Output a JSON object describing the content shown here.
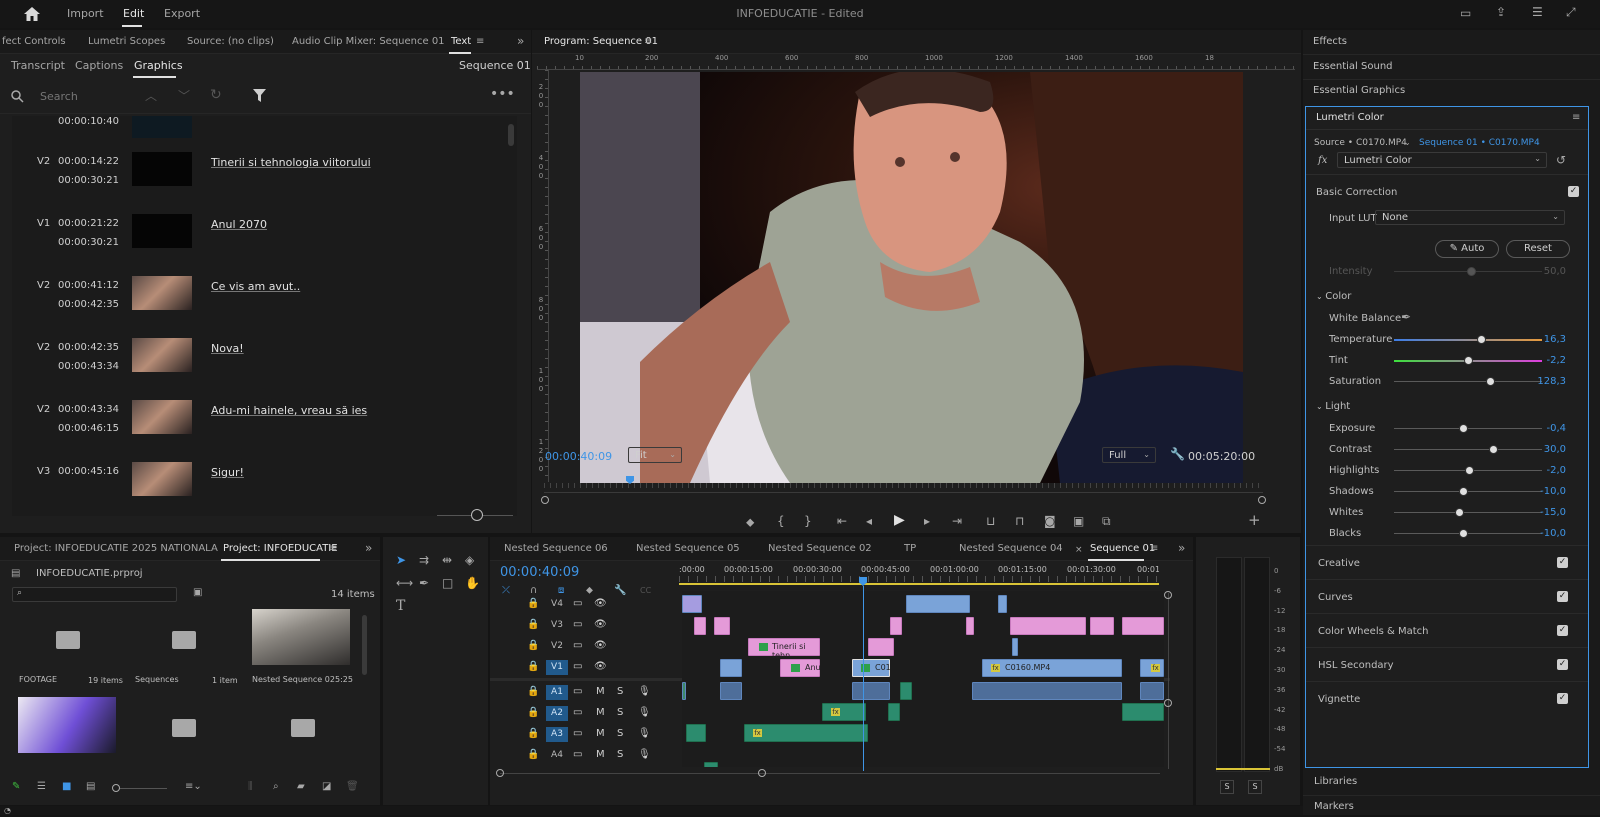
{
  "menu": {
    "home_icon": "home-icon",
    "import": "Import",
    "edit": "Edit",
    "export": "Export",
    "project_name": "INFOEDUCATIE",
    "status": "- Edited"
  },
  "source_panel": {
    "tabs": [
      "fect Controls",
      "Lumetri Scopes",
      "Source: (no clips)",
      "Audio Clip Mixer: Sequence 01",
      "Text"
    ],
    "subtabs": [
      "Transcript",
      "Captions",
      "Graphics"
    ],
    "sequence": "Sequence 01",
    "search_placeholder": "Search",
    "captions": [
      {
        "track": "",
        "start": "00:00:10:40",
        "end": "",
        "text": "",
        "thumb": "dark"
      },
      {
        "track": "V2",
        "start": "00:00:14:22",
        "end": "00:00:30:21",
        "text": "Tinerii si tehnologia viitorului",
        "thumb": "dark"
      },
      {
        "track": "V1",
        "start": "00:00:21:22",
        "end": "00:00:30:21",
        "text": "Anul 2070",
        "thumb": "dark"
      },
      {
        "track": "V2",
        "start": "00:00:41:12",
        "end": "00:00:42:35",
        "text": "Ce vis am avut..",
        "thumb": "room"
      },
      {
        "track": "V2",
        "start": "00:00:42:35",
        "end": "00:00:43:34",
        "text": "Nova!",
        "thumb": "room"
      },
      {
        "track": "V2",
        "start": "00:00:43:34",
        "end": "00:00:46:15",
        "text": "Adu-mi hainele, vreau să ies",
        "thumb": "room"
      },
      {
        "track": "V3",
        "start": "00:00:45:16",
        "end": "",
        "text": "Sigur!",
        "thumb": "room"
      }
    ]
  },
  "program": {
    "title": "Program: Sequence 01",
    "ruler": [
      "10",
      "200",
      "400",
      "600",
      "800",
      "1000",
      "1200",
      "1400",
      "1600",
      "18"
    ],
    "vruler": [
      "2",
      "0",
      "0",
      "4",
      "0",
      "0",
      "6",
      "0",
      "0",
      "8",
      "0",
      "0",
      "1",
      "0",
      "0",
      "1",
      "2",
      "0",
      "0"
    ],
    "timecode": "00:00:40:09",
    "fit": "Fit",
    "quality": "Full",
    "duration": "00:05:20:00"
  },
  "right_panels": {
    "effects": "Effects",
    "essential_sound": "Essential Sound",
    "essential_graphics": "Essential Graphics",
    "lumetri": "Lumetri Color",
    "libraries": "Libraries",
    "markers": "Markers"
  },
  "lumetri": {
    "source": "Source • C0170.MP4",
    "sequence": "Sequence 01 • C0170.MP4",
    "effect": "Lumetri Color",
    "basic_correction": "Basic Correction",
    "input_lut_label": "Input LUT",
    "input_lut": "None",
    "auto": "Auto",
    "reset": "Reset",
    "intensity_label": "Intensity",
    "intensity": "50,0",
    "color_section": "Color",
    "white_balance": "White Balance",
    "temperature_label": "Temperature",
    "temperature": "16,3",
    "tint_label": "Tint",
    "tint": "-2,2",
    "saturation_label": "Saturation",
    "saturation": "128,3",
    "light_section": "Light",
    "exposure_label": "Exposure",
    "exposure": "-0,4",
    "contrast_label": "Contrast",
    "contrast": "30,0",
    "highlights_label": "Highlights",
    "highlights": "-2,0",
    "shadows_label": "Shadows",
    "shadows": "-10,0",
    "whites_label": "Whites",
    "whites": "-15,0",
    "blacks_label": "Blacks",
    "blacks": "-10,0",
    "creative": "Creative",
    "curves": "Curves",
    "color_wheels": "Color Wheels & Match",
    "hsl": "HSL Secondary",
    "vignette": "Vignette"
  },
  "project": {
    "tabs": [
      "Project: INFOEDUCATIE 2025 NATIONALA",
      "Project: INFOEDUCATIE"
    ],
    "file": "INFOEDUCATIE.prproj",
    "count": "14 items",
    "items": [
      {
        "name": "FOOTAGE",
        "meta": "19 items"
      },
      {
        "name": "Sequences",
        "meta": "1 item"
      },
      {
        "name": "Nested Sequence 02",
        "meta": "5:25"
      }
    ]
  },
  "timeline": {
    "tabs": [
      "Nested Sequence 06",
      "Nested Sequence 05",
      "Nested Sequence 02",
      "TP",
      "Nested Sequence 04",
      "Sequence 01"
    ],
    "timecode": "00:00:40:09",
    "ruler": [
      ":00:00",
      "00:00:15:00",
      "00:00:30:00",
      "00:00:45:00",
      "00:01:00:00",
      "00:01:15:00",
      "00:01:30:00",
      "00:01:"
    ],
    "tracks": [
      "V4",
      "V3",
      "V2",
      "V1",
      "A1",
      "A2",
      "A3",
      "A4"
    ],
    "clip_labels": {
      "v2a": "Tinerii si tehn",
      "v1a": "Anu",
      "v1b": "C01",
      "v1c": "C0160.MP4"
    }
  },
  "meter": {
    "scale": [
      "0",
      "-6",
      "-12",
      "-18",
      "-24",
      "-30",
      "-36",
      "-42",
      "-48",
      "-54",
      "dB"
    ],
    "solo_left": "S",
    "solo_right": "S"
  }
}
